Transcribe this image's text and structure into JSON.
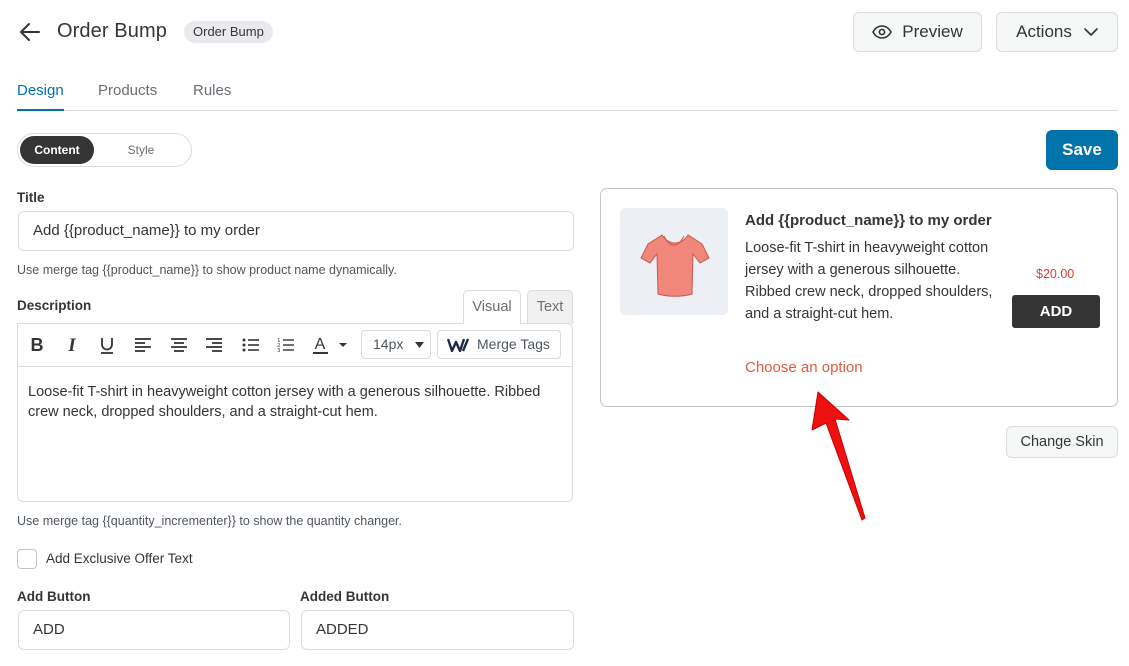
{
  "header": {
    "title": "Order Bump",
    "badge": "Order Bump",
    "preview_label": "Preview",
    "actions_label": "Actions"
  },
  "tabs": [
    {
      "label": "Design",
      "active": true
    },
    {
      "label": "Products",
      "active": false
    },
    {
      "label": "Rules",
      "active": false
    }
  ],
  "mode_toggle": {
    "content_label": "Content",
    "style_label": "Style",
    "selected": "Content"
  },
  "save_label": "Save",
  "form": {
    "title_label": "Title",
    "title_value": "Add {{product_name}} to my order",
    "title_hint": "Use merge tag {{product_name}} to show product name dynamically.",
    "description_label": "Description",
    "editor_tab_visual": "Visual",
    "editor_tab_text": "Text",
    "font_size": "14px",
    "merge_tags_label": "Merge Tags",
    "description_value": "Loose-fit T-shirt in heavyweight cotton jersey with a generous silhouette. Ribbed crew neck, dropped shoulders, and a straight-cut hem.",
    "description_hint": "Use merge tag {{quantity_incrementer}} to show the quantity changer.",
    "exclusive_offer_label": "Add Exclusive Offer Text",
    "exclusive_offer_checked": false,
    "add_button_label": "Add Button",
    "add_button_value": "ADD",
    "added_button_label": "Added Button",
    "added_button_value": "ADDED"
  },
  "preview": {
    "title": "Add {{product_name}} to my order",
    "description": "Loose-fit T-shirt in heavyweight cotton jersey with a generous silhouette. Ribbed crew neck, dropped shoulders, and a straight-cut hem.",
    "price": "$20.00",
    "add_label": "ADD",
    "option_link": "Choose an option",
    "product_image": "tshirt-icon"
  },
  "change_skin_label": "Change Skin",
  "colors": {
    "accent": "#0073aa",
    "dark_button": "#353535",
    "price": "#e03b2d",
    "option_link": "#e05a40",
    "annotation_arrow": "#ee1111"
  }
}
